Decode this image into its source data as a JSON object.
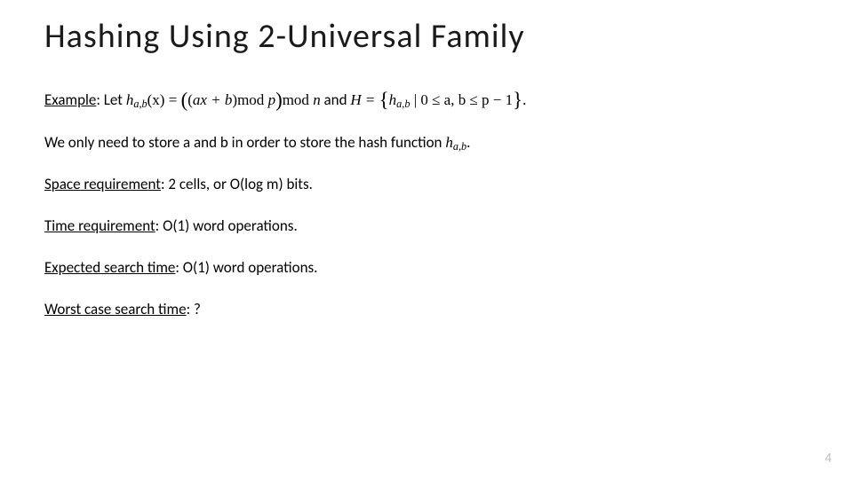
{
  "title": "Hashing Using 2-Universal Family",
  "page_number": "4",
  "example": {
    "label": "Example",
    "let": "Let ",
    "h": "h",
    "sub_ab": "a,b",
    "lpar_x_eq": "(x) = ",
    "bigl": "(",
    "inner_open": "(",
    "ax_plus_b": "ax + b",
    "inner_close": ")",
    "mod": "mod ",
    "p": "p",
    "bigr": ")",
    "n": "n",
    "and": " and ",
    "H_eq": "H = ",
    "lbrace": "{",
    "bar_cond": " | 0 ≤ a, b ≤ p − 1",
    "rbrace": "}",
    "period": "."
  },
  "line_store": {
    "pre": "We only need to store a and b in order to store the hash function ",
    "h": "h",
    "sub": "a,b",
    "post": "."
  },
  "space": {
    "label": "Space requirement",
    "text": ": 2 cells, or O(log m) bits."
  },
  "time": {
    "label": "Time requirement",
    "text": ": O(1) word operations."
  },
  "expected": {
    "label": "Expected search time",
    "text": ": O(1) word operations."
  },
  "worst": {
    "label": "Worst case search time",
    "text": ": ?"
  }
}
